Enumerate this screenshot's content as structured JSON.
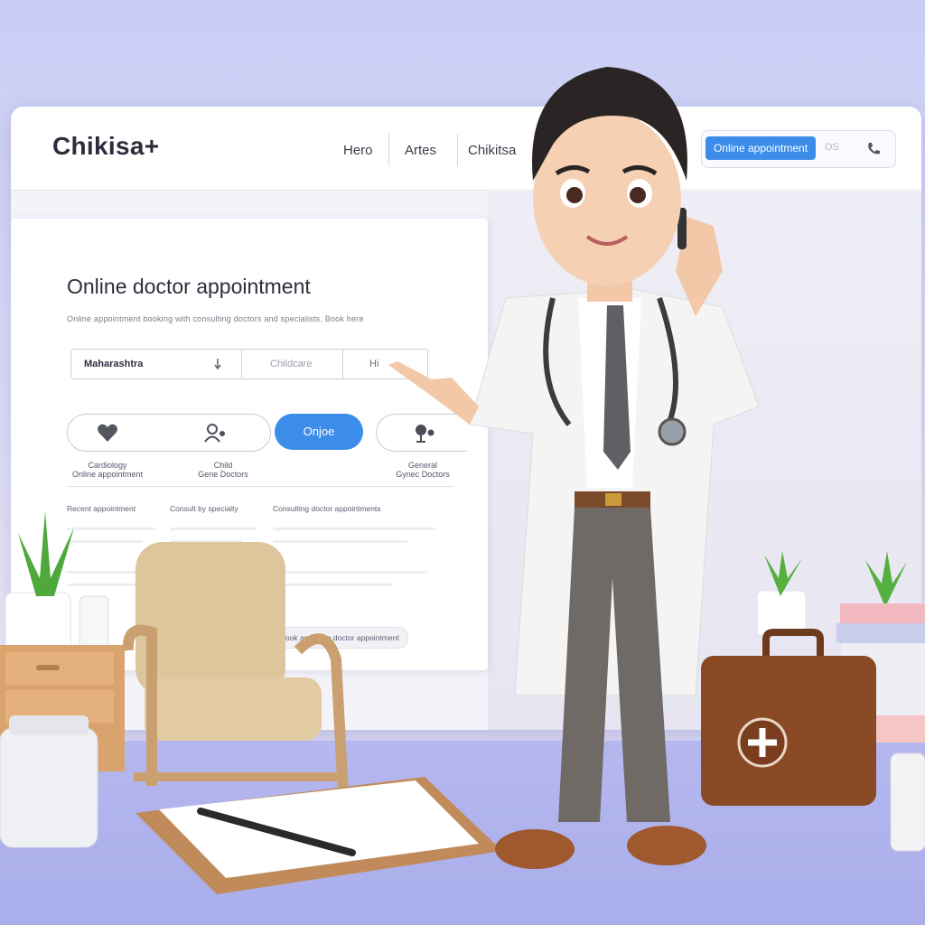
{
  "header": {
    "logo": "Chikisa+",
    "nav": [
      "Hero",
      "Artes",
      "Chikitsa"
    ],
    "search_button": "Online appointment",
    "search_hint": "OS"
  },
  "hero": {
    "headline": "Online doctor appointment",
    "subline": "Online appointment booking with consulting doctors and specialists. Book here"
  },
  "form": {
    "field1": "Maharashtra",
    "field2": "Childcare",
    "field3": "Hi"
  },
  "quick": {
    "cta": "Onjoe",
    "labels": [
      "Cardiology\nOnline appointment",
      "Child\nGene Doctors",
      "",
      "General\nGynec Doctors"
    ]
  },
  "columns": [
    "Recent appointment",
    "Consult by specialty",
    "Consulting doctor appointments"
  ],
  "bottom_chip": "Book an online doctor appointment",
  "colors": {
    "accent": "#3c8dea",
    "brand_text": "#2b2d3a"
  },
  "icons": [
    "heart-icon",
    "doctor-icon",
    "stethoscope-icon",
    "phone-icon",
    "chevron-down-icon"
  ]
}
